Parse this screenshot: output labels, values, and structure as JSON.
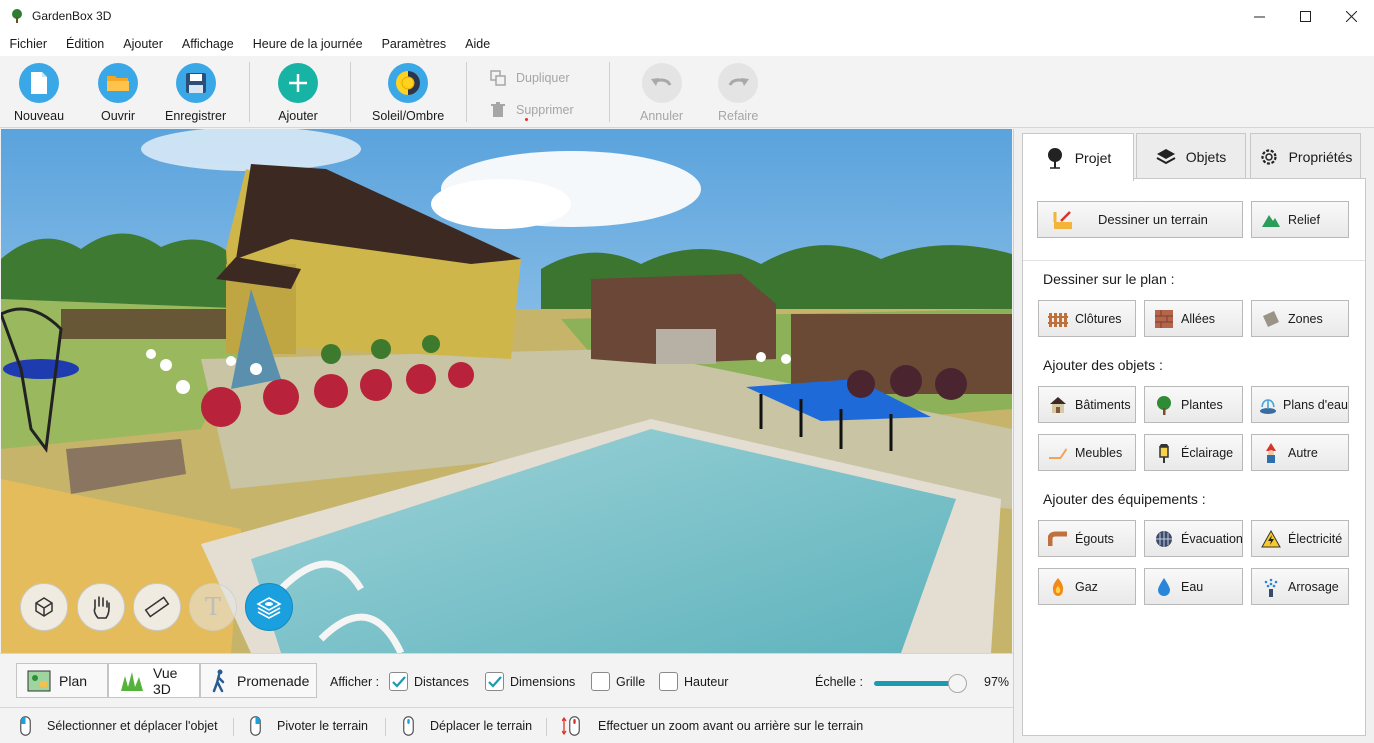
{
  "window": {
    "title": "GardenBox 3D"
  },
  "menu": [
    "Fichier",
    "Édition",
    "Ajouter",
    "Affichage",
    "Heure de la journée",
    "Paramètres",
    "Aide"
  ],
  "toolbar": {
    "new_label": "Nouveau",
    "open_label": "Ouvrir",
    "save_label": "Enregistrer",
    "add_label": "Ajouter",
    "sun_label": "Soleil/Ombre",
    "duplicate_label": "Dupliquer",
    "delete_label": "Supprimer",
    "undo_label": "Annuler",
    "redo_label": "Refaire"
  },
  "viewport_tools": [
    {
      "name": "rotate-object-icon"
    },
    {
      "name": "hand-pan-icon"
    },
    {
      "name": "ruler-icon"
    },
    {
      "name": "text-icon",
      "glyph": "T"
    },
    {
      "name": "layers-view-icon"
    }
  ],
  "view_modes": {
    "plan_label": "Plan",
    "vue3d_label": "Vue 3D",
    "walk_label": "Promenade",
    "active": "Vue 3D"
  },
  "display_options": {
    "label": "Afficher :",
    "items": [
      {
        "label": "Distances",
        "checked": true
      },
      {
        "label": "Dimensions",
        "checked": true
      },
      {
        "label": "Grille",
        "checked": false
      },
      {
        "label": "Hauteur",
        "checked": false
      }
    ]
  },
  "scale": {
    "label": "Échelle :",
    "value_text": "97%",
    "value": 0.97
  },
  "statusbar": [
    "Sélectionner et déplacer l'objet",
    "Pivoter le terrain",
    "Déplacer le terrain",
    "Effectuer un zoom avant ou arrière sur le terrain"
  ],
  "panel": {
    "tabs": [
      {
        "label": "Projet",
        "active": true
      },
      {
        "label": "Objets",
        "active": false
      },
      {
        "label": "Propriétés",
        "active": false
      }
    ],
    "draw_terrain_label": "Dessiner un terrain",
    "relief_label": "Relief",
    "draw_on_plan_title": "Dessiner sur le plan :",
    "draw_items": [
      "Clôtures",
      "Allées",
      "Zones"
    ],
    "add_objects_title": "Ajouter des objets :",
    "object_items": [
      "Bâtiments",
      "Plantes",
      "Plans d'eau",
      "Meubles",
      "Éclairage",
      "Autre"
    ],
    "add_equipment_title": "Ajouter des équipements :",
    "equipment_items": [
      "Égouts",
      "Évacuation",
      "Électricité",
      "Gaz",
      "Eau",
      "Arrosage"
    ]
  },
  "colors": {
    "accent": "#1ba0df",
    "slider": "#1a9bb0",
    "pool_water": "#7fc6cc",
    "lawn": "#c6b46a"
  }
}
